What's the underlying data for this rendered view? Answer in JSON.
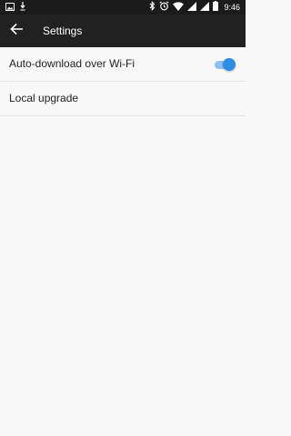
{
  "status_bar": {
    "time": "9:46",
    "icons": [
      "image-icon",
      "download-icon",
      "bluetooth-icon",
      "alarm-icon",
      "wifi-icon",
      "signal-icon",
      "signal-icon",
      "battery-icon"
    ]
  },
  "toolbar": {
    "title": "Settings"
  },
  "settings": [
    {
      "label": "Auto-download over Wi-Fi",
      "has_toggle": true,
      "toggle_on": true
    },
    {
      "label": "Local upgrade",
      "has_toggle": false
    }
  ],
  "colors": {
    "toolbar_bg": "#212121",
    "status_bg": "#1b1b1b",
    "page_bg": "#f8f8f8",
    "toggle_accent": "#2d8ee6"
  }
}
